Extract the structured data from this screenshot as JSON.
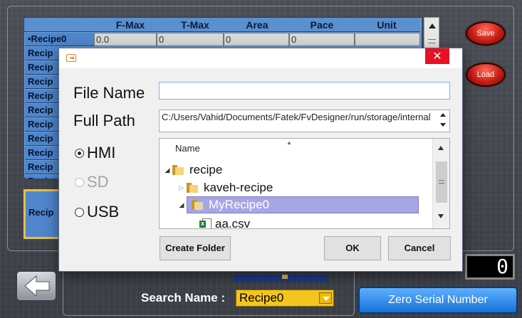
{
  "background": {
    "table": {
      "columns": [
        "F-Max",
        "T-Max",
        "Area",
        "Pace",
        "Unit"
      ],
      "row_labels": [
        "•Recipe0",
        "Recip",
        "Recip",
        "Recip",
        "Recip",
        "Recip",
        "Recip",
        "Recip",
        "Recip",
        "Recip",
        "Recip"
      ],
      "first_row_values": [
        "0.0",
        "0",
        "0",
        "0",
        ""
      ]
    },
    "second_table_label": "Recip",
    "save_label": "Save",
    "load_label": "Load",
    "counter_value": "0",
    "search_label": "Search Name :",
    "search_value": "Recipe0",
    "zero_serial_label": "Zero Serial Number"
  },
  "dialog": {
    "close_glyph": "✕",
    "file_name_label": "File Name",
    "file_name_value": "",
    "full_path_label": "Full Path",
    "full_path_value": "C:/Users/Vahid/Documents/Fatek/FvDesigner/run/storage/internal",
    "storage_options": [
      {
        "label": "HMI",
        "checked": true,
        "enabled": true
      },
      {
        "label": "SD",
        "checked": false,
        "enabled": false
      },
      {
        "label": "USB",
        "checked": false,
        "enabled": true
      }
    ],
    "tree": {
      "column_header": "Name",
      "nodes": [
        {
          "label": "recipe",
          "expanded": true
        },
        {
          "label": "kaveh-recipe",
          "expanded": false
        },
        {
          "label": "MyRecipe0",
          "expanded": true,
          "selected": true
        },
        {
          "label": "aa.csv"
        }
      ]
    },
    "create_folder_label": "Create Folder",
    "ok_label": "OK",
    "cancel_label": "Cancel"
  }
}
